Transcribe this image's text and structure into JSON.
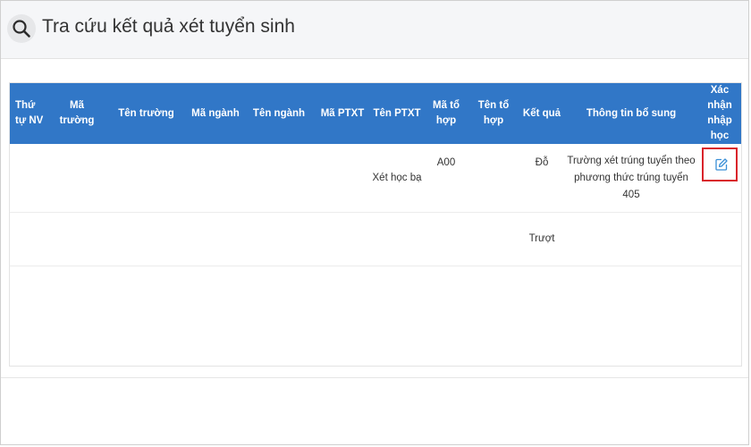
{
  "header": {
    "title": "Tra cứu kết quả xét tuyển sinh",
    "icon": "search-icon"
  },
  "table": {
    "columns": [
      "Thứ tự NV",
      "Mã trường",
      "Tên trường",
      "Mã ngành",
      "Tên ngành",
      "Mã PTXT",
      "Tên PTXT",
      "Mã tổ hợp",
      "Tên tổ hợp",
      "Kết quả",
      "Thông tin bổ sung",
      "Xác nhận nhập học"
    ],
    "rows": [
      {
        "thu_tu_nv": "",
        "ma_truong": "",
        "ten_truong": "",
        "ma_nganh": "",
        "ten_nganh": "",
        "ma_ptxt": "",
        "ten_ptxt": "Xét học bạ",
        "ma_to_hop": "A00",
        "ten_to_hop": "",
        "ket_qua": "Đỗ",
        "thong_tin_bo_sung": "Trường xét trúng tuyển theo phương thức trúng tuyển 405",
        "xac_nhan_icon": "edit-icon"
      },
      {
        "thu_tu_nv": "",
        "ma_truong": "",
        "ten_truong": "",
        "ma_nganh": "",
        "ten_nganh": "",
        "ma_ptxt": "",
        "ten_ptxt": "",
        "ma_to_hop": "",
        "ten_to_hop": "",
        "ket_qua": "Trượt",
        "thong_tin_bo_sung": ""
      }
    ]
  },
  "colors": {
    "header_bg": "#3177c7",
    "highlight_border": "#d9232b",
    "edit_icon": "#3a8fd6"
  }
}
